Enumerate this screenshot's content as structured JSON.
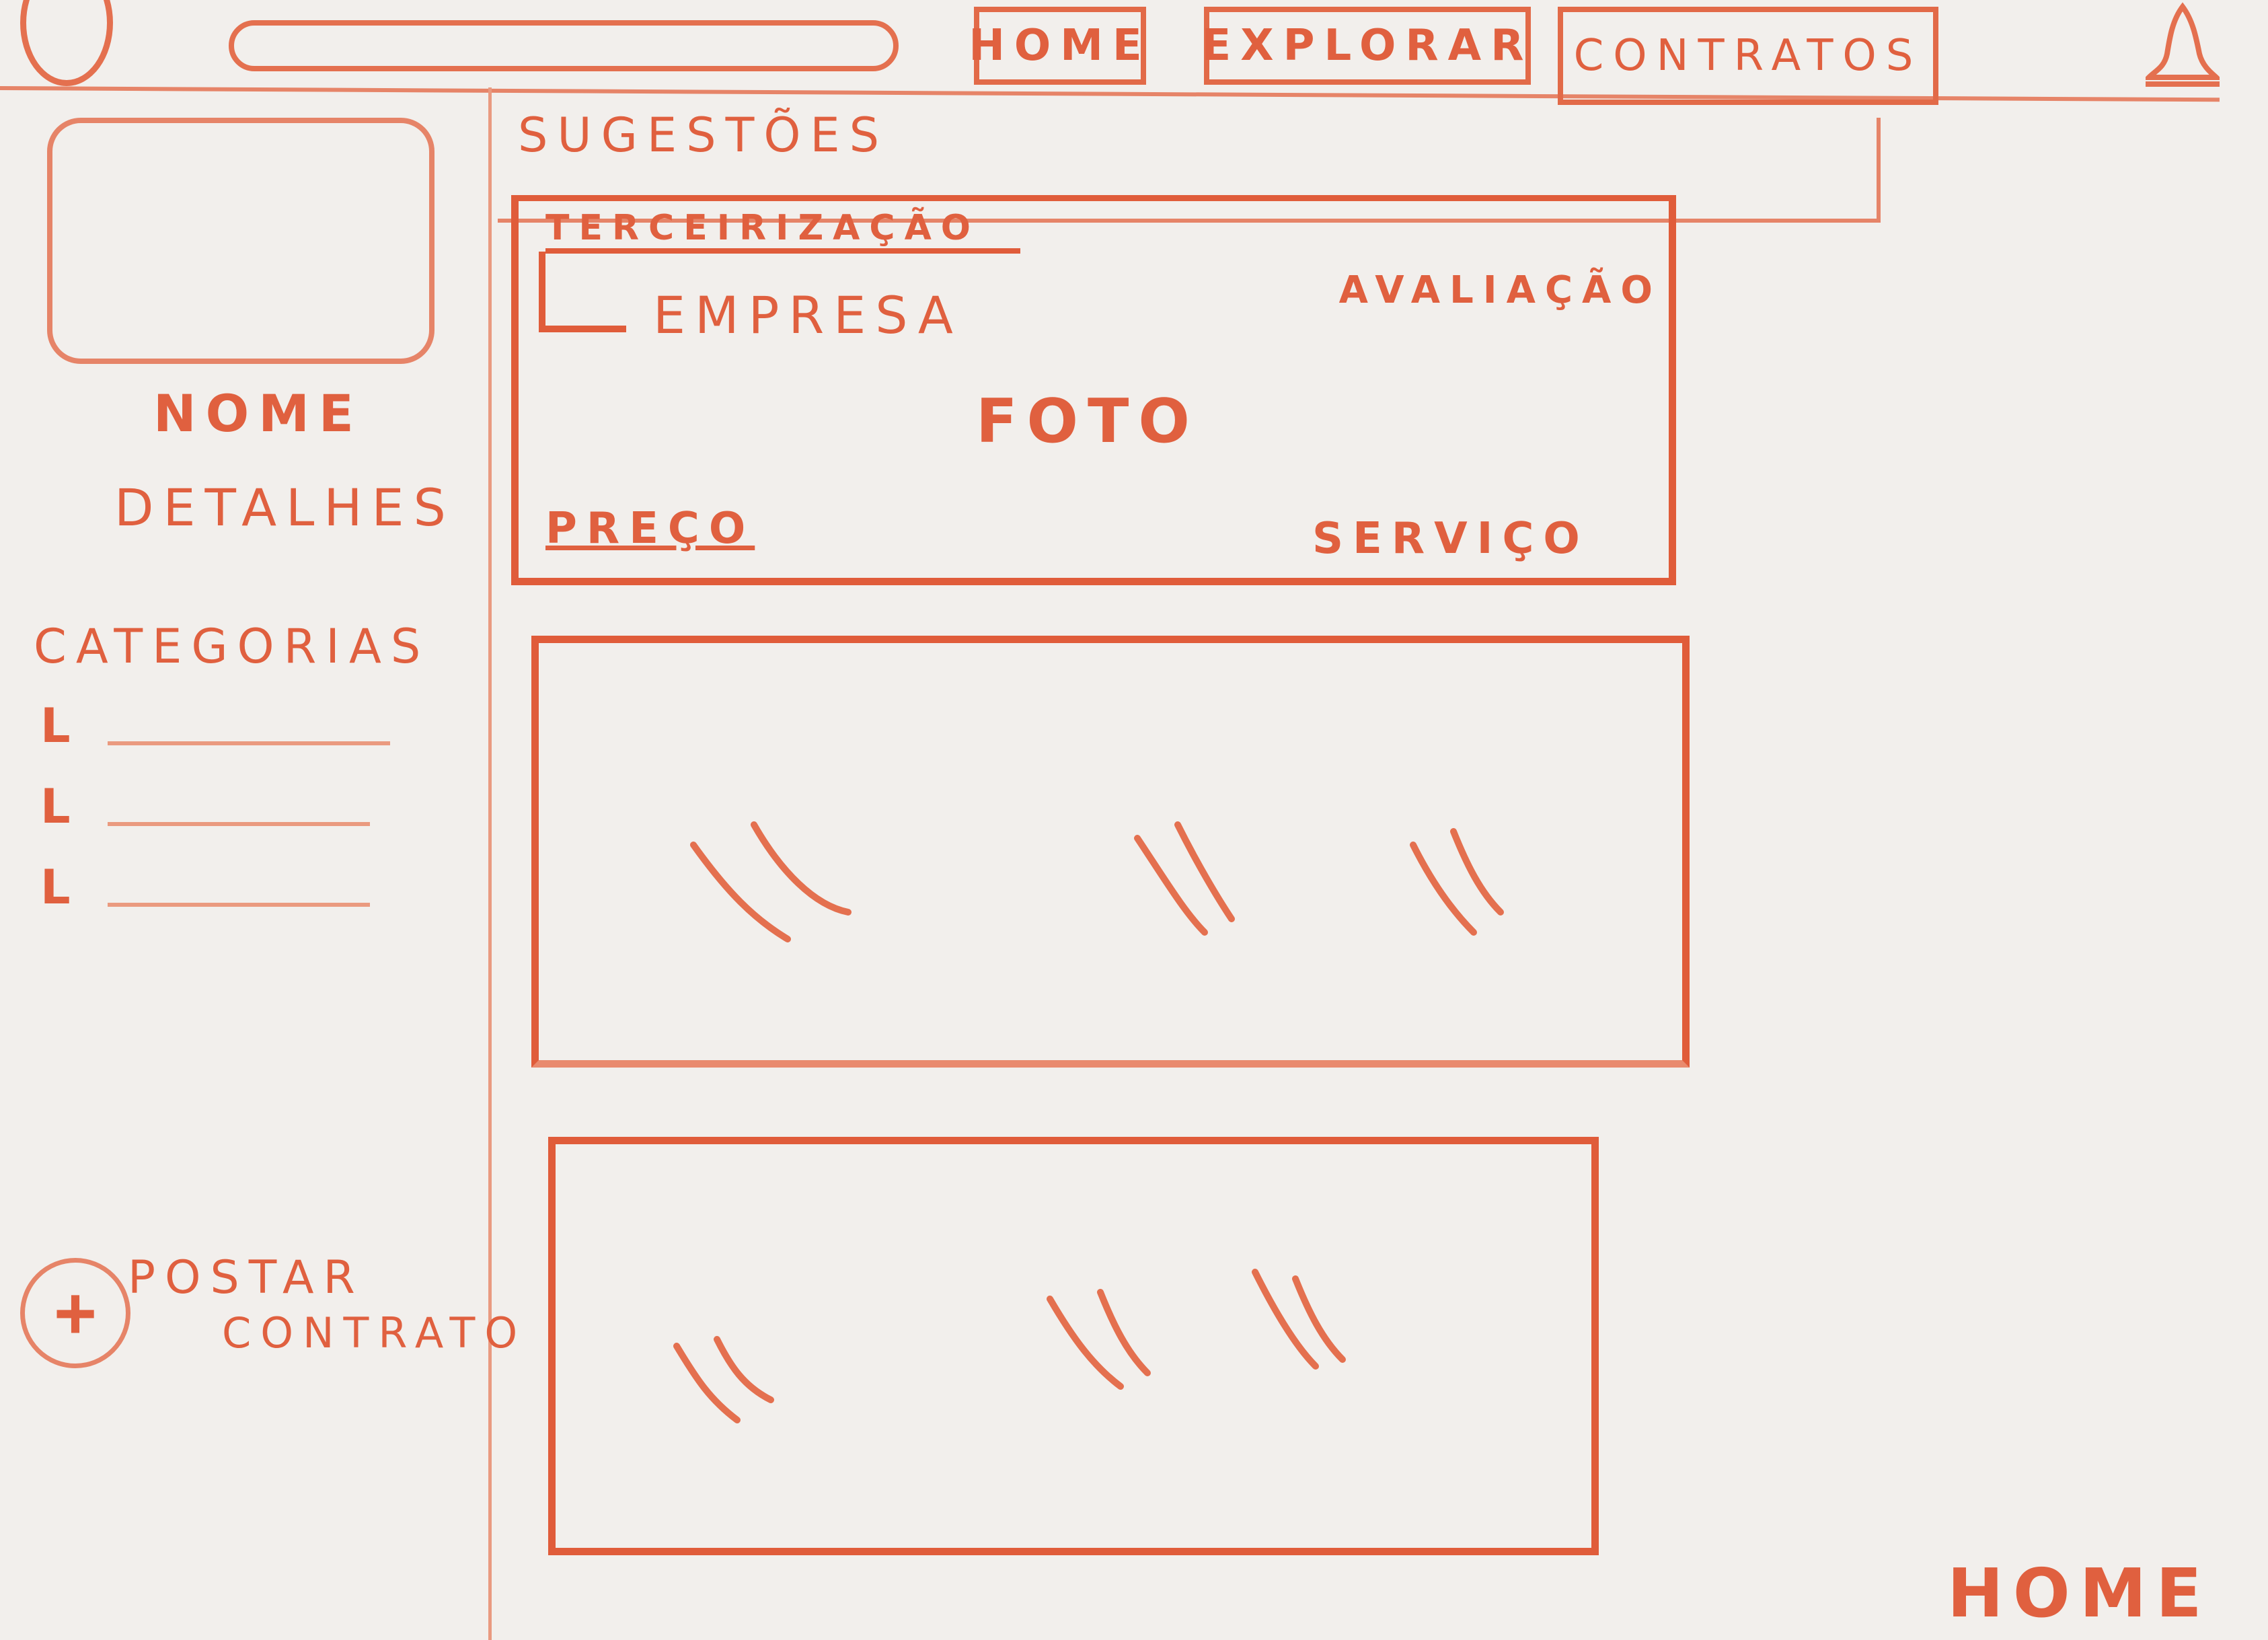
{
  "header": {
    "search": {
      "placeholder": ""
    },
    "tabs": [
      {
        "label": "HOME"
      },
      {
        "label": "EXPLORAR"
      },
      {
        "label": "CONTRATOS"
      }
    ]
  },
  "sidebar": {
    "name": "NOME",
    "details": "DETALHES",
    "categories_title": "CATEGORIAS",
    "category_mark": "L",
    "post_contract": {
      "line1": "POSTAR",
      "line2": "CONTRATO",
      "icon": "plus-icon"
    }
  },
  "main": {
    "suggestions_title": "SUGESTÕES",
    "featured_card": {
      "category": "TERCEIRIZAÇÃO",
      "company": "EMPRESA",
      "rating": "AVALIAÇÃO",
      "photo": "FOTO",
      "price": "PREÇO",
      "service": "SERVIÇO"
    }
  },
  "footer": {
    "page_label": "HOME"
  },
  "colors": {
    "ink": "#e0603f",
    "paper": "#f2efec"
  }
}
